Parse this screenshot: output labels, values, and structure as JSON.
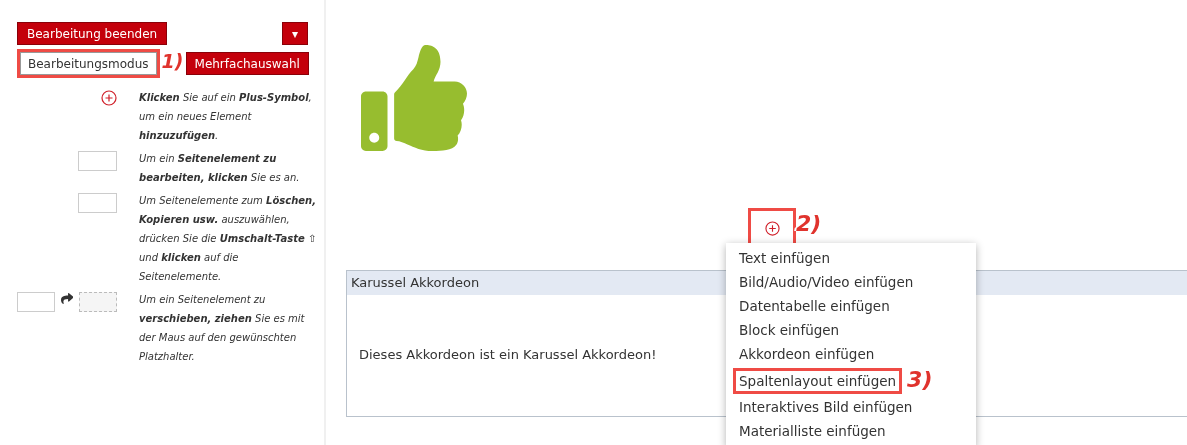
{
  "toolbar": {
    "finish_button": "Bearbeitung beenden",
    "dropdown_caret": "▾",
    "mode_buttons": [
      {
        "label": "Bearbeitungsmodus",
        "selected": true,
        "highlighted": true,
        "callout": "1)"
      },
      {
        "label": "Mehrfachauswahl",
        "selected": false,
        "highlighted": false
      }
    ]
  },
  "help": [
    {
      "kind": "add",
      "text": "**Klicken** *Sie auf ein* **Plus-Symbol**, *um ein neues Element* **hinzuzufügen**."
    },
    {
      "kind": "edit",
      "text": "*Um ein* **Seitenelement zu bearbeiten, klicken** *Sie es an.*"
    },
    {
      "kind": "select",
      "text": "*Um Seitenelemente zum* **Löschen, Kopieren usw.** *auszuwählen, drücken Sie die* **Umschalt-Taste** *⇧ und* **klicken** *auf die Seitenelemente.*"
    },
    {
      "kind": "move",
      "text": "*Um ein Seitenelement zu* **verschieben, ziehen** *Sie es mit der Maus auf den gewünschten Platzhalter.*"
    }
  ],
  "add_button": {
    "highlighted": true,
    "callout": "2)"
  },
  "accordion": {
    "title": "Karussel Akkordeon",
    "body": "Dieses Akkordeon ist ein Karussel Akkordeon!"
  },
  "insert_menu": [
    {
      "label": "Text einfügen",
      "highlighted": false
    },
    {
      "label": "Bild/Audio/Video einfügen",
      "highlighted": false
    },
    {
      "label": "Datentabelle einfügen",
      "highlighted": false
    },
    {
      "label": "Block einfügen",
      "highlighted": false
    },
    {
      "label": "Akkordeon einfügen",
      "highlighted": false
    },
    {
      "label": "Spaltenlayout einfügen",
      "highlighted": true,
      "callout": "3)"
    },
    {
      "label": "Interaktives Bild einfügen",
      "highlighted": false
    },
    {
      "label": "Materialliste einfügen",
      "highlighted": false
    }
  ]
}
